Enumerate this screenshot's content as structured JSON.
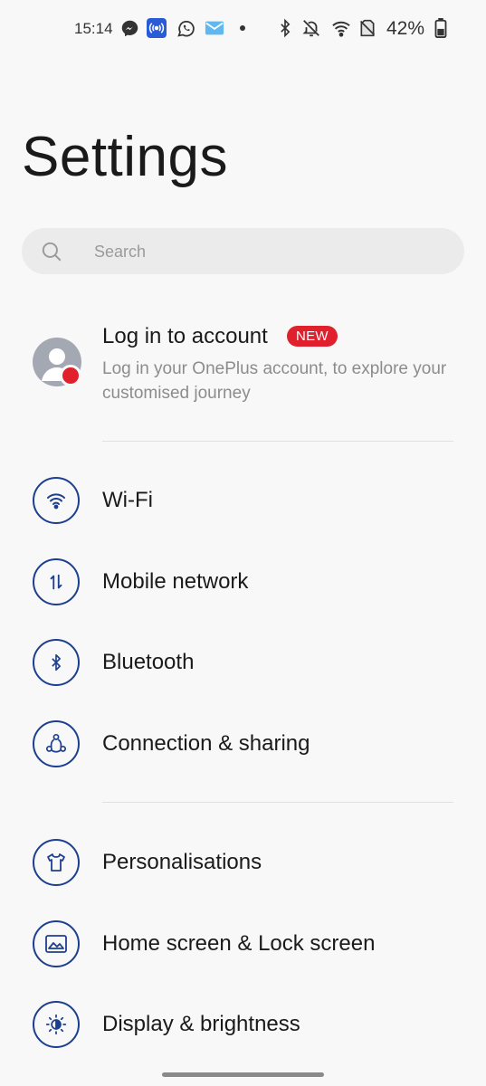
{
  "status_bar": {
    "time": "15:14",
    "battery_percent": "42%",
    "left_icons": [
      "messenger-icon",
      "nfc-radio-icon",
      "whatsapp-icon",
      "mail-icon",
      "dot-icon"
    ],
    "right_icons": [
      "bluetooth-icon",
      "bell-off-icon",
      "wifi-icon",
      "no-sim-icon",
      "battery-icon"
    ]
  },
  "header": {
    "title": "Settings"
  },
  "search": {
    "placeholder": "Search"
  },
  "account": {
    "title": "Log in to account",
    "badge": "NEW",
    "subtitle": "Log in your OnePlus account, to explore your customised journey"
  },
  "groups": [
    {
      "items": [
        {
          "label": "Wi-Fi",
          "icon": "wifi-icon"
        },
        {
          "label": "Mobile network",
          "icon": "mobile-data-icon"
        },
        {
          "label": "Bluetooth",
          "icon": "bluetooth-icon"
        },
        {
          "label": "Connection & sharing",
          "icon": "connection-icon"
        }
      ]
    },
    {
      "items": [
        {
          "label": "Personalisations",
          "icon": "tshirt-icon"
        },
        {
          "label": "Home screen & Lock screen",
          "icon": "picture-icon"
        },
        {
          "label": "Display & brightness",
          "icon": "brightness-icon"
        }
      ]
    }
  ],
  "colors": {
    "accent": "#1d3f8f",
    "badge": "#e0202d",
    "background": "#f8f8f8"
  }
}
